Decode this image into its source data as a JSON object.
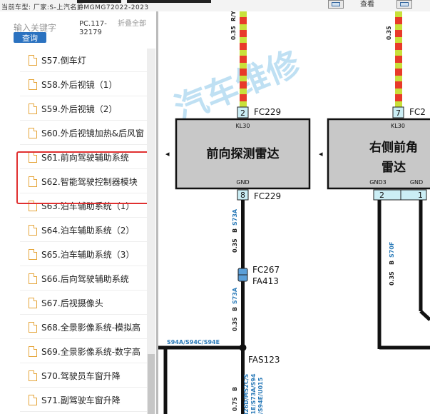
{
  "header": {
    "car_info": "当前车型:  厂家:S-上汽名爵MGMG72022-2023",
    "right_label": "查看"
  },
  "sidebar": {
    "search_placeholder": "输入关键字",
    "query_button": "查询",
    "pc_code": "PC.117-32179",
    "fold_all": "折叠全部",
    "items": [
      {
        "label": "S57.倒车灯"
      },
      {
        "label": "S58.外后视镜（1）"
      },
      {
        "label": "S59.外后视镜（2）"
      },
      {
        "label": "S60.外后视镜加热&后风窗"
      },
      {
        "label": "S61.前向驾驶辅助系统"
      },
      {
        "label": "S62.智能驾驶控制器模块"
      },
      {
        "label": "S63.泊车辅助系统（1）"
      },
      {
        "label": "S64.泊车辅助系统（2）"
      },
      {
        "label": "S65.泊车辅助系统（3）"
      },
      {
        "label": "S66.后向驾驶辅助系统"
      },
      {
        "label": "S67.后视摄像头"
      },
      {
        "label": "S68.全景影像系统-模拟高"
      },
      {
        "label": "S69.全景影像系统-数字高"
      },
      {
        "label": "S70.驾驶员车窗升降"
      },
      {
        "label": "S71.副驾驶车窗升降"
      }
    ]
  },
  "diagram": {
    "watermark": "汽车维修",
    "module_front": {
      "title": "前向探测雷达",
      "pin_top_label": "KL30",
      "pin_bottom_label": "GND",
      "top_pin": "2",
      "top_conn": "FC229",
      "bottom_pin": "8",
      "bottom_conn": "FC229"
    },
    "module_right": {
      "title_line1": "右侧前角",
      "title_line2": "雷达",
      "pin_top_label": "KL30",
      "gnd3_label": "GND3",
      "gnd_label": "GND",
      "top_pin": "7",
      "top_conn": "FC2",
      "pin_a": "2",
      "pin_b": "1"
    },
    "wire_labels": {
      "left_top": "0.35",
      "left_top_color": "R/Y",
      "right_top": "0.35",
      "s73a_1": "S73A",
      "b_1": "B",
      "gauge_1": "0.35",
      "s73a_2": "S73A",
      "b_2": "B",
      "gauge_2": "0.35",
      "b_3": "B",
      "gauge_3": "0.75",
      "s70f": "S70F",
      "b_right": "B",
      "gauge_right": "0.35"
    },
    "connector_fc267": "FC267",
    "connector_fa413": "FA413",
    "splice_bus": "S94A/S94C/S94E",
    "splice_name": "FAS123",
    "splice_list_1": "M26D/M52C/S",
    "splice_list_2": "51E/S73A/S94",
    "splice_list_3": "C/S94E/U015"
  }
}
